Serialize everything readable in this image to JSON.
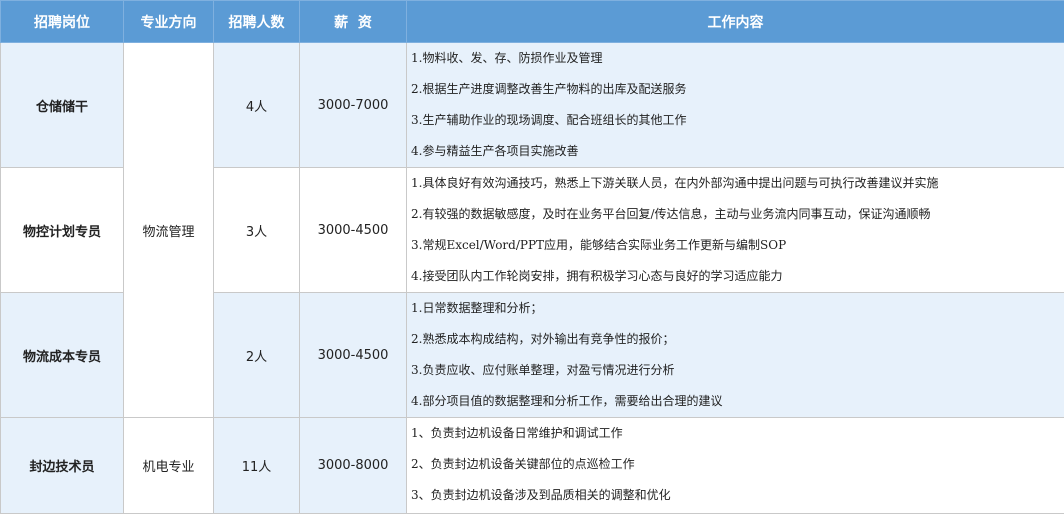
{
  "headers": {
    "position": "招聘岗位",
    "direction": "专业方向",
    "headcount": "招聘人数",
    "salary": "薪  资",
    "content": "工作内容"
  },
  "rows": [
    {
      "position": "仓储储干",
      "headcount": "4人",
      "salary": "3000-7000",
      "duties": [
        "1.物料收、发、存、防损作业及管理",
        "2.根据生产进度调整改善生产物料的出库及配送服务",
        "3.生产辅助作业的现场调度、配合班组长的其他工作",
        "4.参与精益生产各项目实施改善"
      ]
    },
    {
      "position": "物控计划专员",
      "direction": "物流管理",
      "headcount": "3人",
      "salary": "3000-4500",
      "duties": [
        "1.具体良好有效沟通技巧，熟悉上下游关联人员，在内外部沟通中提出问题与可执行改善建议并实施",
        "2.有较强的数据敏感度，及时在业务平台回复/传达信息，主动与业务流内同事互动，保证沟通顺畅",
        "3.常规Excel/Word/PPT应用，能够结合实际业务工作更新与编制SOP",
        "4.接受团队内工作轮岗安排，拥有积极学习心态与良好的学习适应能力"
      ]
    },
    {
      "position": "物流成本专员",
      "headcount": "2人",
      "salary": "3000-4500",
      "duties": [
        "1.日常数据整理和分析；",
        "2.熟悉成本构成结构，对外输出有竞争性的报价；",
        "3.负责应收、应付账单整理，对盈亏情况进行分析",
        "4.部分项目值的数据整理和分析工作，需要给出合理的建议"
      ]
    },
    {
      "position": "封边技术员",
      "direction": "机电专业",
      "headcount": "11人",
      "salary": "3000-8000",
      "duties": [
        "1、负责封边机设备日常维护和调试工作",
        "2、负责封边机设备关键部位的点巡检工作",
        "3、负责封边机设备涉及到品质相关的调整和优化"
      ]
    }
  ]
}
